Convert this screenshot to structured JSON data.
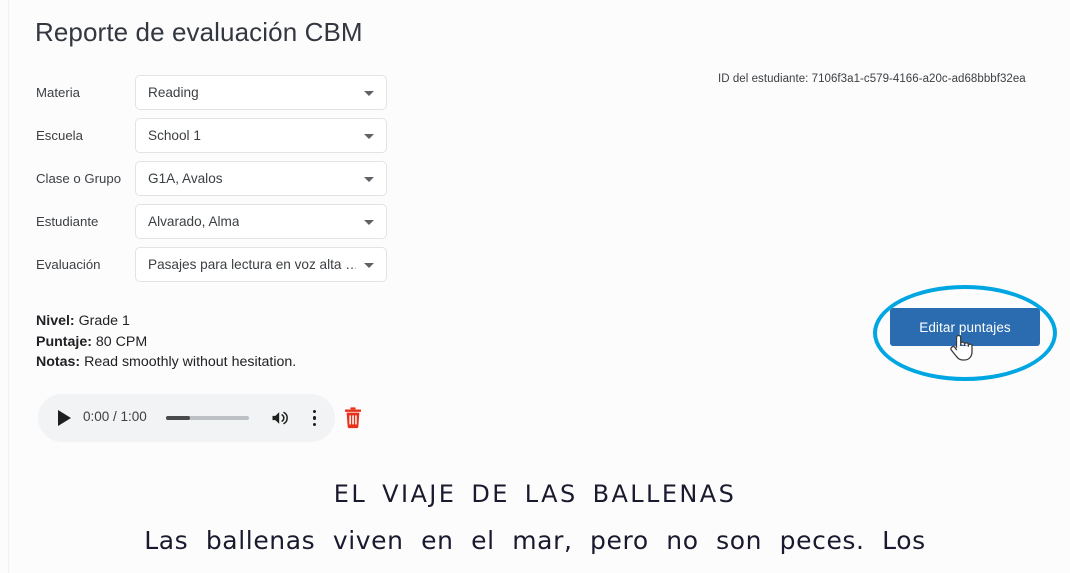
{
  "page": {
    "title": "Reporte de evaluación CBM",
    "student_id_label": "ID del estudiante: 7106f3a1-c579-4166-a20c-ad68bbbf32ea"
  },
  "form": {
    "rows": [
      {
        "label": "Materia",
        "value": "Reading",
        "name": "subject"
      },
      {
        "label": "Escuela",
        "value": "School 1",
        "name": "school"
      },
      {
        "label": "Clase o Grupo",
        "value": "G1A, Avalos",
        "name": "class-group"
      },
      {
        "label": "Estudiante",
        "value": "Alvarado, Alma",
        "name": "student"
      },
      {
        "label": "Evaluación",
        "value": "Pasajes para lectura en voz alta …",
        "name": "assessment"
      }
    ]
  },
  "details": {
    "level_label": "Nivel:",
    "level_value": " Grade 1",
    "score_label": "Puntaje:",
    "score_value": " 80 CPM",
    "notes_label": "Notas:",
    "notes_value": " Read smoothly without hesitation."
  },
  "audio": {
    "time": "0:00 / 1:00",
    "progress_percent": 29,
    "play_icon": "play-icon",
    "volume_icon": "volume-icon",
    "menu_icon": "more-vertical-icon",
    "delete_icon": "trash-icon"
  },
  "actions": {
    "edit_scores_label": "Editar puntajes"
  },
  "passage": {
    "title": "EL VIAJE DE LAS BALLENAS",
    "line1": "Las ballenas viven en el mar, pero no son peces. Los"
  },
  "colors": {
    "accent_button": "#2b6cb0",
    "highlight_ellipse": "#00a6e2",
    "delete_icon": "#e8311a",
    "background": "#fdfcfd"
  }
}
